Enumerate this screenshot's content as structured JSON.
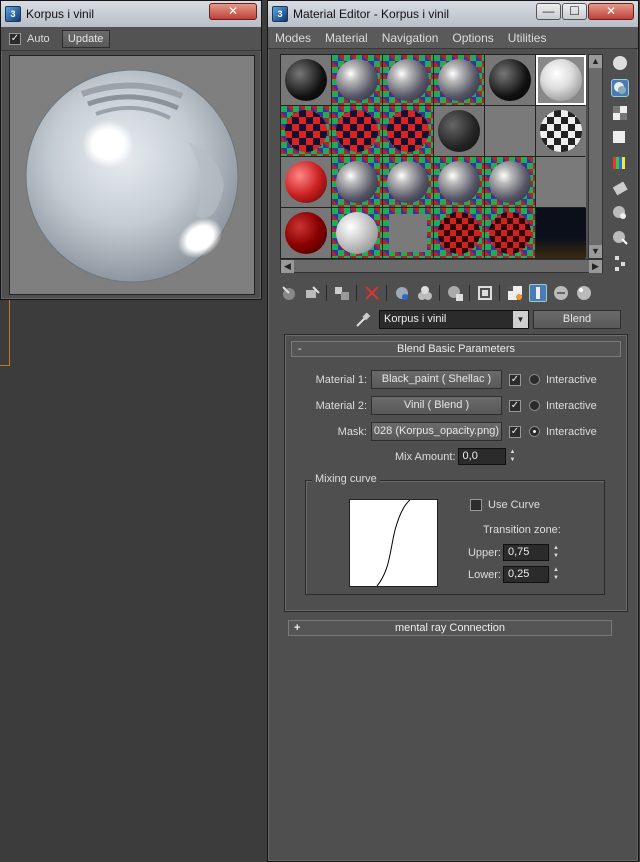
{
  "preview_window": {
    "title": "Korpus i vinil",
    "close_glyph": "✕",
    "auto_label": "Auto",
    "auto_checked": true,
    "update_label": "Update"
  },
  "material_editor": {
    "title": "Material Editor - Korpus i vinil",
    "minimize_glyph": "—",
    "maximize_glyph": "☐",
    "close_glyph": "✕",
    "menu": [
      "Modes",
      "Material",
      "Navigation",
      "Options",
      "Utilities"
    ],
    "slots": [
      {
        "kind": "black-sphere"
      },
      {
        "kind": "checker-chrome"
      },
      {
        "kind": "checker-chrome"
      },
      {
        "kind": "checker-chrome"
      },
      {
        "kind": "black-sphere"
      },
      {
        "kind": "chrome-white",
        "selected": true
      },
      {
        "kind": "checker-sphere"
      },
      {
        "kind": "checker-sphere"
      },
      {
        "kind": "checker-sphere"
      },
      {
        "kind": "dark-sphere"
      },
      {
        "kind": "flat-grey"
      },
      {
        "kind": "bw-checker-sphere"
      },
      {
        "kind": "red-sphere"
      },
      {
        "kind": "checker-chrome"
      },
      {
        "kind": "checker-chrome"
      },
      {
        "kind": "checker-chrome"
      },
      {
        "kind": "checker-chrome"
      },
      {
        "kind": "flat-grey"
      },
      {
        "kind": "dark-red-sphere"
      },
      {
        "kind": "checker-white"
      },
      {
        "kind": "flat-grey-checker"
      },
      {
        "kind": "red-checker-sphere"
      },
      {
        "kind": "red-checker-sphere"
      },
      {
        "kind": "night-scene"
      }
    ],
    "material_name": "Korpus i vinil",
    "material_type": "Blend",
    "rollout_title": "Blend Basic Parameters",
    "rollout_sign": "-",
    "material1_label": "Material 1:",
    "material1_value": "Black_paint  ( Shellac )",
    "material2_label": "Material 2:",
    "material2_value": "Vinil  ( Blend )",
    "mask_label": "Mask:",
    "mask_value": "028 (Korpus_opacity.png)",
    "interactive_label": "Interactive",
    "interactive_selected": "mask",
    "mix_amount_label": "Mix Amount:",
    "mix_amount_value": "0,0",
    "mixing_curve_label": "Mixing curve",
    "use_curve_label": "Use Curve",
    "use_curve_checked": false,
    "transition_zone_label": "Transition zone:",
    "upper_label": "Upper:",
    "upper_value": "0,75",
    "lower_label": "Lower:",
    "lower_value": "0,25",
    "mr_connection_label": "mental ray Connection",
    "mr_connection_sign": "+"
  },
  "colors": {
    "ui_dark": "#4f4f4f",
    "selection_blue": "#4a7bb4",
    "delete_red": "#d33"
  }
}
